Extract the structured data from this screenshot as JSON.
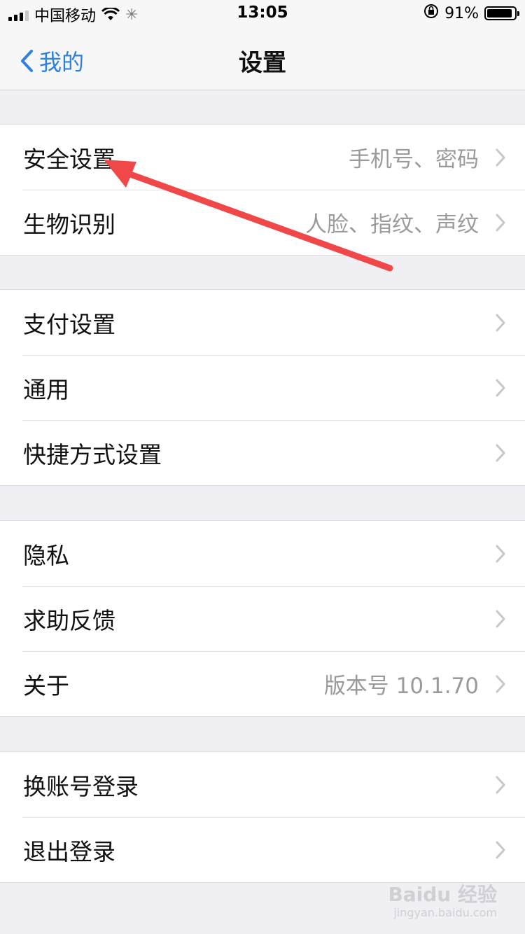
{
  "status_bar": {
    "carrier": "中国移动",
    "time": "13:05",
    "battery_percent": "91%",
    "battery_level": 0.91
  },
  "nav": {
    "back_label": "我的",
    "title": "设置"
  },
  "groups": [
    {
      "rows": [
        {
          "label": "安全设置",
          "detail": "手机号、密码"
        },
        {
          "label": "生物识别",
          "detail": "人脸、指纹、声纹"
        }
      ]
    },
    {
      "rows": [
        {
          "label": "支付设置",
          "detail": ""
        },
        {
          "label": "通用",
          "detail": ""
        },
        {
          "label": "快捷方式设置",
          "detail": ""
        }
      ]
    },
    {
      "rows": [
        {
          "label": "隐私",
          "detail": ""
        },
        {
          "label": "求助反馈",
          "detail": ""
        },
        {
          "label": "关于",
          "detail": "版本号 10.1.70"
        }
      ]
    },
    {
      "rows": [
        {
          "label": "换账号登录",
          "detail": ""
        },
        {
          "label": "退出登录",
          "detail": ""
        }
      ]
    }
  ],
  "watermark": {
    "brand": "Baidu 经验",
    "url": "jingyan.baidu.com"
  },
  "colors": {
    "accent": "#2e7fe0",
    "annotation_arrow": "#f04848"
  }
}
